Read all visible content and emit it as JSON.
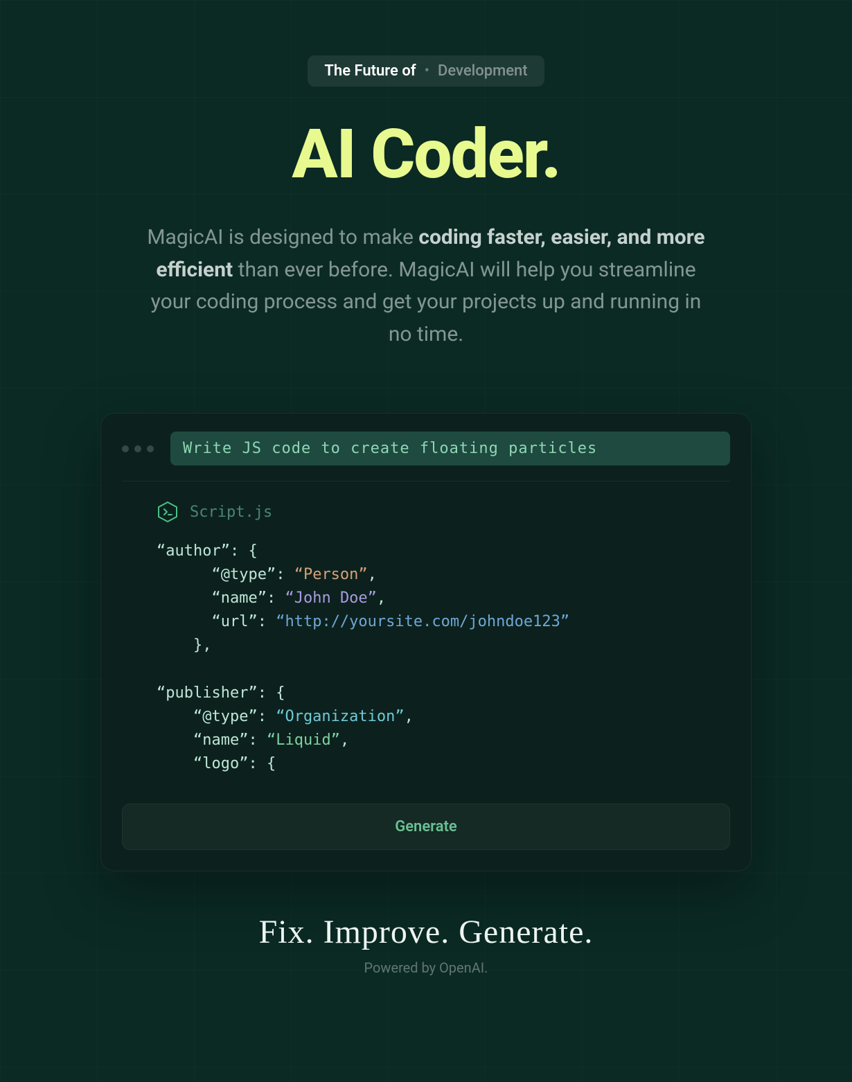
{
  "pill": {
    "prefix": "The Future of",
    "suffix": "Development"
  },
  "hero_title": "AI Coder.",
  "lead_pre": "MagicAI is designed to make ",
  "lead_bold": "coding faster, easier, and more efficient",
  "lead_post": " than ever before. MagicAI will help you streamline your coding process and get your projects up and running in no time.",
  "editor": {
    "prompt": "Write JS code to create floating particles",
    "file_name": "Script.js",
    "code": {
      "author_key": "“author”",
      "type_key": "“@type”",
      "person_val": "“Person”",
      "name_key": "“name”",
      "johndoe_val": "“John Doe”",
      "url_key": "“url”",
      "url_val": "“http://yoursite.com/johndoe123”",
      "publisher_key": "“publisher”",
      "org_val": "“Organization”",
      "liquid_val": "“Liquid”",
      "logo_key": "“logo”"
    },
    "generate_label": "Generate"
  },
  "tagline": "Fix. Improve. Generate.",
  "powered": "Powered by OpenAI."
}
